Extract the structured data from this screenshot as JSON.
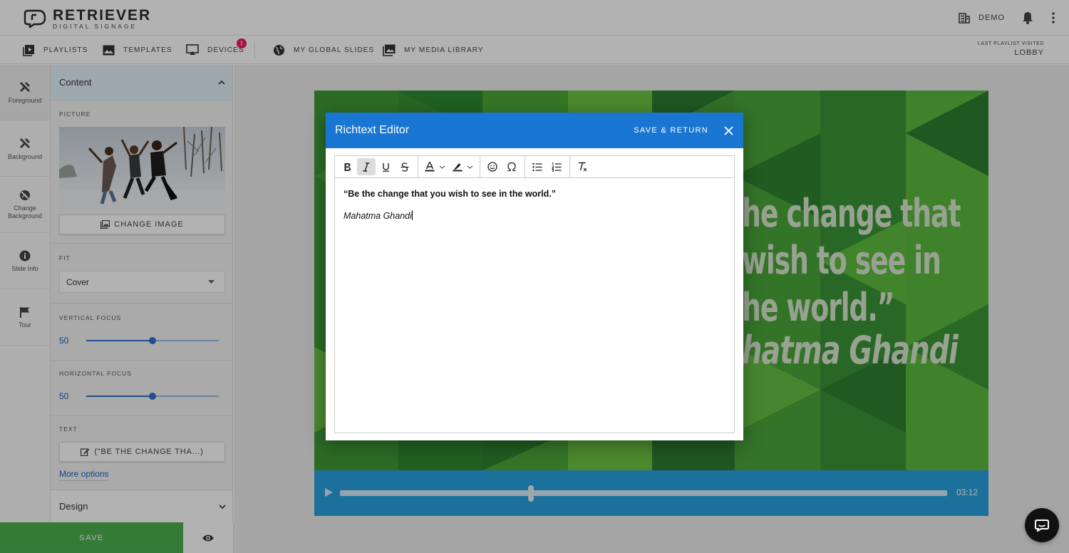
{
  "brand": {
    "title": "RETRIEVER",
    "subtitle": "DIGITAL SIGNAGE"
  },
  "header": {
    "org_label": "DEMO",
    "icons": [
      "building-icon",
      "bell-icon",
      "more-vert-icon"
    ]
  },
  "nav": {
    "items": [
      {
        "label": "PLAYLISTS",
        "icon": "playlist-play-icon"
      },
      {
        "label": "TEMPLATES",
        "icon": "image-icon"
      },
      {
        "label": "DEVICES",
        "icon": "cast-icon"
      },
      {
        "label": "MY GLOBAL SLIDES",
        "icon": "globe-icon"
      },
      {
        "label": "MY MEDIA LIBRARY",
        "icon": "photo-library-icon"
      }
    ],
    "devices_badge": "!",
    "last_visited_label": "LAST PLAYLIST VISITED",
    "last_visited_value": "LOBBY"
  },
  "rail": {
    "items": [
      {
        "label": "Foreground",
        "icon": "tools-icon"
      },
      {
        "label": "Background",
        "icon": "tools-icon"
      },
      {
        "label": "Change Background",
        "icon": "block-icon"
      },
      {
        "label": "Slide Info",
        "icon": "info-icon"
      },
      {
        "label": "Tour",
        "icon": "flag-icon"
      }
    ]
  },
  "panel": {
    "section_title": "Content",
    "picture_label": "PICTURE",
    "change_image_label": "CHANGE IMAGE",
    "fit_label": "FIT",
    "fit_value": "Cover",
    "vertical_focus_label": "VERTICAL FOCUS",
    "vertical_focus_value": 50,
    "horizontal_focus_label": "HORIZONTAL FOCUS",
    "horizontal_focus_value": 50,
    "text_label": "TEXT",
    "text_button_label": "(\"BE THE CHANGE THA...)",
    "more_options_label": "More options",
    "design_label": "Design"
  },
  "footer": {
    "save_label": "SAVE"
  },
  "slide": {
    "quote_lines": [
      "he change that",
      "wish to see in",
      "he world.”"
    ],
    "author": "hatma Ghandi",
    "colors": {
      "green_light": "#5fb83f",
      "green_dark": "#2d7a32"
    }
  },
  "player": {
    "time": "03:12",
    "progress": 0.315
  },
  "dialog": {
    "title": "Richtext Editor",
    "save_label": "SAVE & RETURN",
    "toolbar": [
      "bold",
      "italic",
      "underline",
      "strikethrough",
      "text-color",
      "highlight",
      "emoji",
      "special-char",
      "bullet-list",
      "numbered-list",
      "clear-format"
    ],
    "quote": "“Be the change that you wish to see in the world.”",
    "author": "Mahatma Ghandi"
  },
  "colors": {
    "primary": "#1976d2",
    "save_green": "#4caf50",
    "badge": "#e91e63",
    "player": "#29a3e0"
  }
}
